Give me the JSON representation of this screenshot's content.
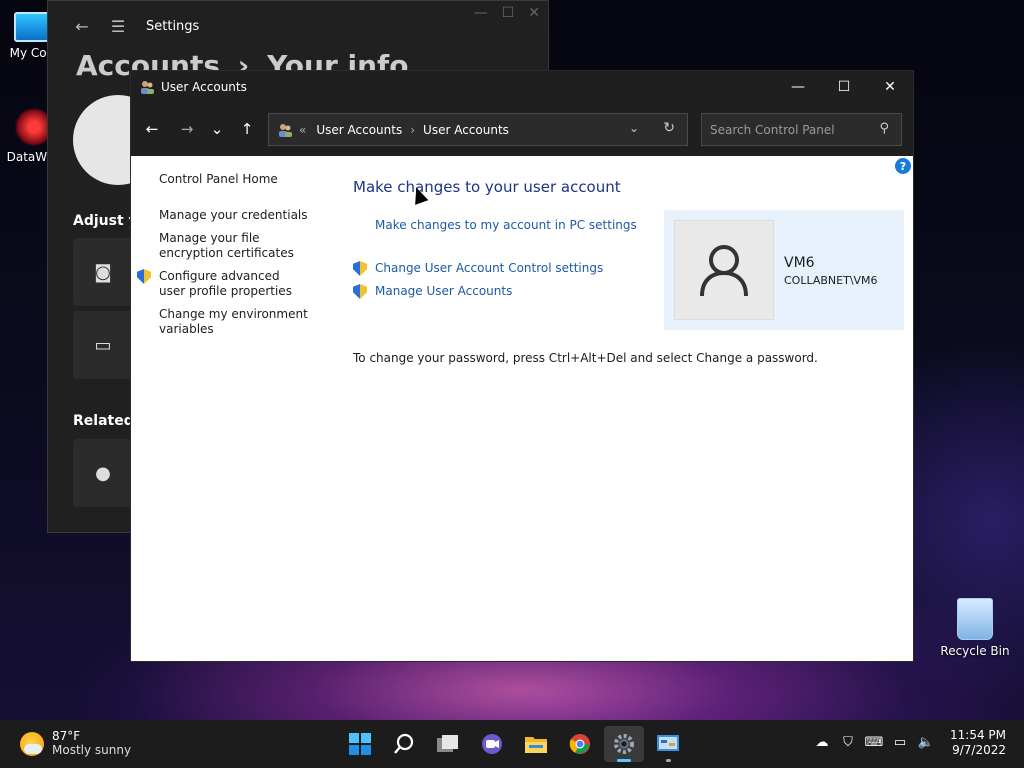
{
  "desktop": {
    "icons": [
      {
        "label": "My Com",
        "icon": "computer-icon"
      },
      {
        "label": "DataWag",
        "icon": "datawagon-icon"
      },
      {
        "label": "Recycle Bin",
        "icon": "recycle-bin-icon"
      }
    ]
  },
  "settings": {
    "title": "Settings",
    "heading_part1": "Accounts",
    "heading_sep": "›",
    "heading_part2": "Your info",
    "section_adjust": "Adjust yo",
    "section_related": "Related s"
  },
  "user_accounts": {
    "title": "User Accounts",
    "address": {
      "prefix": "«",
      "crumbs": [
        "User Accounts",
        "User Accounts"
      ],
      "sep": "›"
    },
    "search_placeholder": "Search Control Panel",
    "help_label": "?",
    "left_links": [
      "Control Panel Home",
      "Manage your credentials",
      "Manage your file encryption certificates",
      "Configure advanced user profile properties",
      "Change my environment variables"
    ],
    "main_title": "Make changes to your user account",
    "links": {
      "pc_settings": "Make changes to my account in PC settings",
      "uac": "Change User Account Control settings",
      "manage": "Manage User Accounts"
    },
    "note": "To change your password, press Ctrl+Alt+Del and select Change a password.",
    "user": {
      "name": "VM6",
      "account": "COLLABNET\\VM6"
    }
  },
  "taskbar": {
    "weather_temp": "87°F",
    "weather_desc": "Mostly sunny",
    "time": "11:54 PM",
    "date": "9/7/2022",
    "apps": [
      "start-icon",
      "search-icon",
      "task-view-icon",
      "chat-icon",
      "file-explorer-icon",
      "chrome-icon",
      "settings-icon",
      "control-panel-icon"
    ]
  },
  "colors": {
    "link": "#1c5aa6",
    "title_blue": "#1e3287",
    "user_card_bg": "#e6f1fb",
    "titlebar_dark": "#1f1f1f"
  }
}
